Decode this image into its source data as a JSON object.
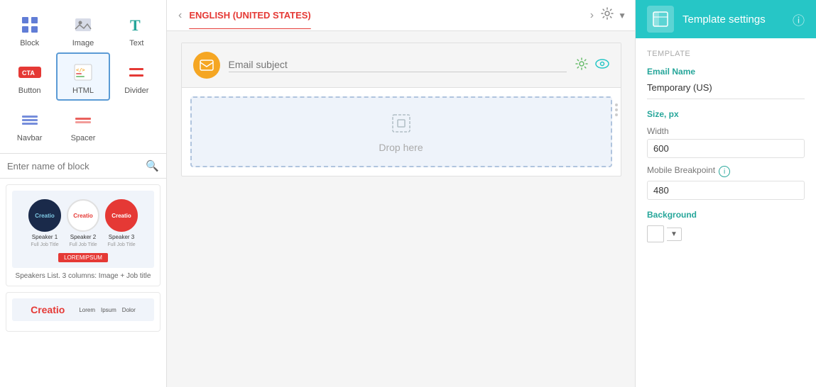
{
  "sidebar": {
    "tools": [
      {
        "id": "block",
        "label": "Block",
        "icon": "block-icon"
      },
      {
        "id": "image",
        "label": "Image",
        "icon": "image-icon"
      },
      {
        "id": "text",
        "label": "Text",
        "icon": "text-icon"
      },
      {
        "id": "button",
        "label": "Button",
        "icon": "button-icon"
      },
      {
        "id": "html",
        "label": "HTML",
        "icon": "html-icon",
        "active": true
      },
      {
        "id": "divider",
        "label": "Divider",
        "icon": "divider-icon"
      },
      {
        "id": "navbar",
        "label": "Navbar",
        "icon": "navbar-icon"
      },
      {
        "id": "spacer",
        "label": "Spacer",
        "icon": "spacer-icon"
      }
    ],
    "search_placeholder": "Enter name of block",
    "block_preview_label": "Speakers List. 3 columns: Image + Job title"
  },
  "language_bar": {
    "label": "ENGLISH (UNITED STATES)"
  },
  "canvas": {
    "email_subject_placeholder": "Email subject",
    "drop_label": "Drop here"
  },
  "right_panel": {
    "title": "Template settings",
    "tab": "Template",
    "email_name_label": "Email Name",
    "email_name_value": "Temporary (US)",
    "size_label": "Size, px",
    "width_label": "Width",
    "width_value": "600",
    "mobile_breakpoint_label": "Mobile Breakpoint",
    "mobile_breakpoint_value": "480",
    "background_label": "Background"
  }
}
